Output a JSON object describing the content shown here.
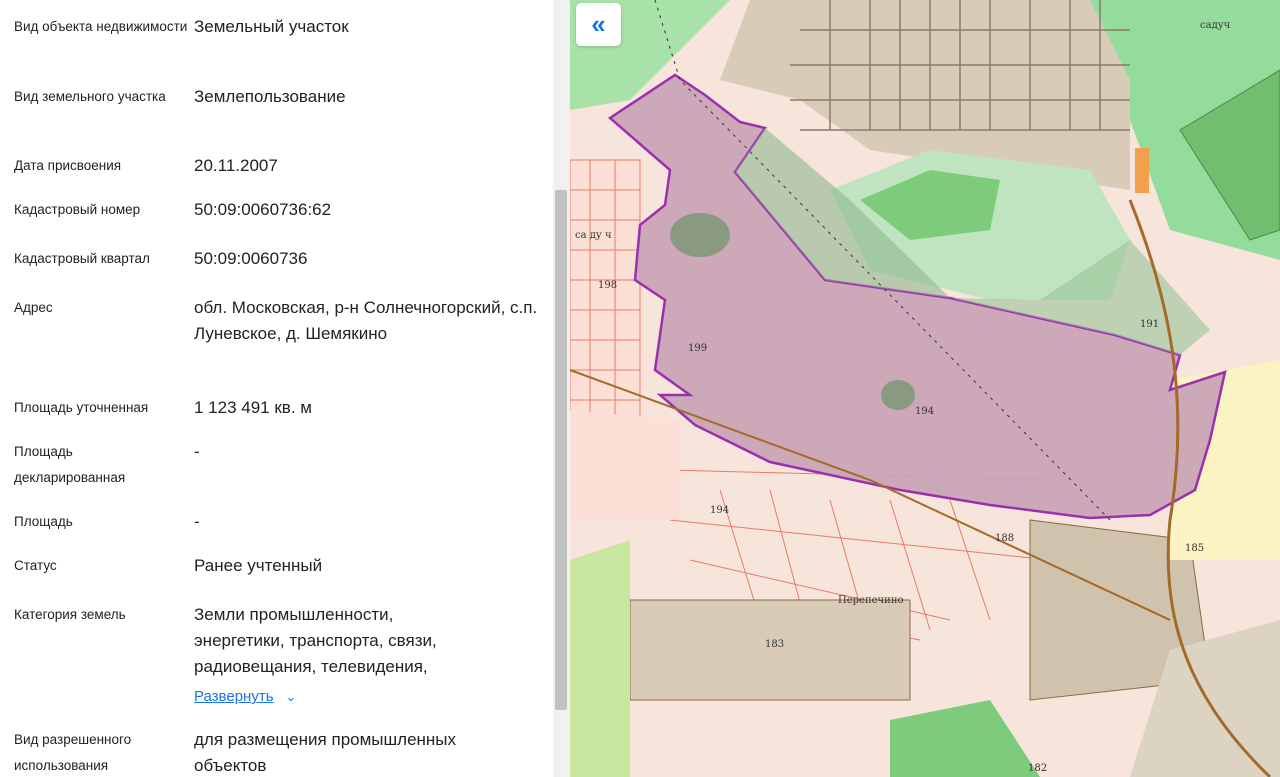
{
  "fields": [
    {
      "label": "Вид объекта недвижимости",
      "value": "Земельный участок"
    },
    {
      "label": "Вид земельного участка",
      "value": "Землепользование"
    },
    {
      "label": "Дата присвоения",
      "value": "20.11.2007"
    },
    {
      "label": "Кадастровый номер",
      "value": "50:09:0060736:62"
    },
    {
      "label": "Кадастровый квартал",
      "value": "50:09:0060736"
    },
    {
      "label": "Адрес",
      "value": "обл. Московская, р-н Солнечногорский, с.п. Луневское, д. Шемякино"
    },
    {
      "label": "Площадь уточненная",
      "value": "1 123 491 кв. м"
    },
    {
      "label": "Площадь декларированная",
      "value": "-"
    },
    {
      "label": "Площадь",
      "value": "-"
    },
    {
      "label": "Статус",
      "value": "Ранее учтенный"
    },
    {
      "label": "Категория земель",
      "value": "Земли промышленности, энергетики, транспорта, связи, радиовещания, телевидения,"
    },
    {
      "label": "Вид разрешенного использования",
      "value": "для размещения промышленных объектов"
    }
  ],
  "expand_label": "Развернуть",
  "map": {
    "collapse_icon": "double-chevron-left-icon",
    "labels": {
      "sad1": "садуч",
      "sad2": "са ду ч",
      "l198": "198",
      "l199": "199",
      "l194a": "194",
      "l191": "191",
      "l194b": "194",
      "l188": "188",
      "l185": "185",
      "l183": "183",
      "l182": "182",
      "village": "Перепечино"
    },
    "colors": {
      "parcel": "#c9a3b6",
      "parcel_border": "#9b2fae",
      "forest": "#93dc9c",
      "garden": "#d8ccb8"
    }
  }
}
